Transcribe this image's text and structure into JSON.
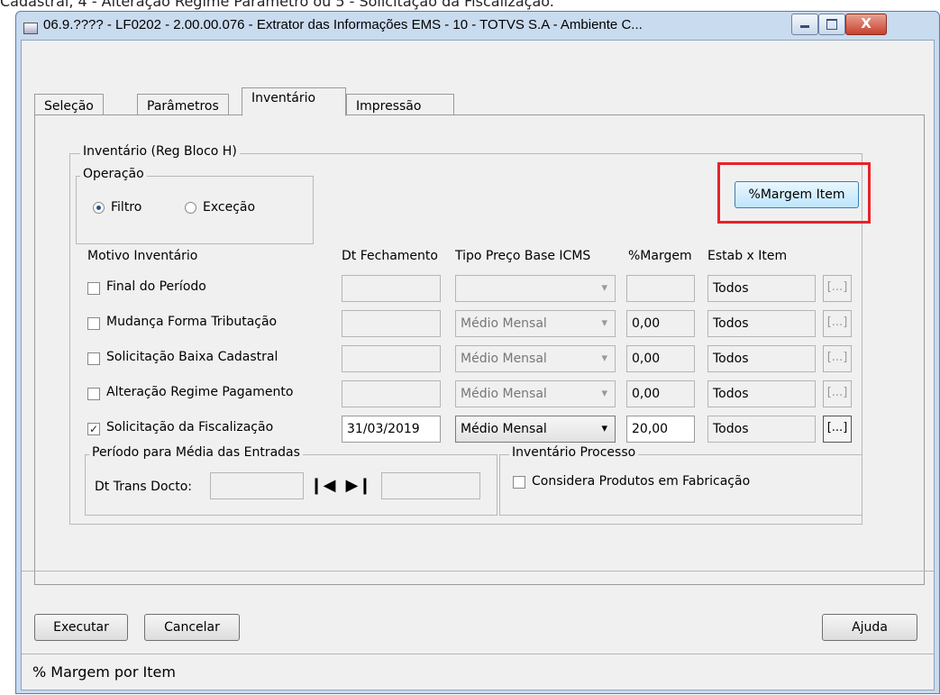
{
  "top_caption": "Cadastral, 4 - Alteração Regime Parâmetro ou 5 - Solicitação da Fiscalização.",
  "window": {
    "title": "06.9.???? - LF0202 - 2.00.00.076 - Extrator das Informações EMS - 10 - TOTVS S.A - Ambiente C...",
    "close_glyph": "X"
  },
  "tabs": [
    "Seleção",
    "Parâmetros",
    "Inventário",
    "Impressão"
  ],
  "active_tab": "Inventário",
  "inventario": {
    "group_title": "Inventário (Reg Bloco H)",
    "operacao": {
      "title": "Operação",
      "options": [
        "Filtro",
        "Exceção"
      ],
      "selected": "Filtro"
    },
    "margem_button": "%Margem Item",
    "headers": {
      "motivo": "Motivo Inventário",
      "dt_fechamento": "Dt Fechamento",
      "tipo_preco": "Tipo Preço Base ICMS",
      "margem": "%Margem",
      "estab": "Estab x Item"
    },
    "rows": [
      {
        "label": "Final do Período",
        "checked": false,
        "date": "",
        "tipo": "",
        "margem": "",
        "estab": "Todos",
        "button": "[...]"
      },
      {
        "label": "Mudança Forma Tributação",
        "checked": false,
        "date": "",
        "tipo": "Médio Mensal",
        "margem": "0,00",
        "estab": "Todos",
        "button": "[...]"
      },
      {
        "label": "Solicitação Baixa Cadastral",
        "checked": false,
        "date": "",
        "tipo": "Médio Mensal",
        "margem": "0,00",
        "estab": "Todos",
        "button": "[...]"
      },
      {
        "label": "Alteração Regime Pagamento",
        "checked": false,
        "date": "",
        "tipo": "Médio Mensal",
        "margem": "0,00",
        "estab": "Todos",
        "button": "[...]"
      },
      {
        "label": "Solicitação da Fiscalização",
        "checked": true,
        "date": "31/03/2019",
        "tipo": "Médio Mensal",
        "margem": "20,00",
        "estab": "Todos",
        "button": "[...]"
      }
    ],
    "periodo": {
      "title": "Período para Média das Entradas",
      "label": "Dt Trans Docto:",
      "start": "",
      "end": ""
    },
    "processo": {
      "title": "Inventário Processo",
      "checkbox_label": "Considera Produtos em Fabricação",
      "checked": false
    }
  },
  "buttons": {
    "executar": "Executar",
    "cancelar": "Cancelar",
    "ajuda": "Ajuda"
  },
  "status_text": "% Margem por Item",
  "colors": {
    "highlight": "#e8222a",
    "window_frame": "#c9dbee"
  }
}
